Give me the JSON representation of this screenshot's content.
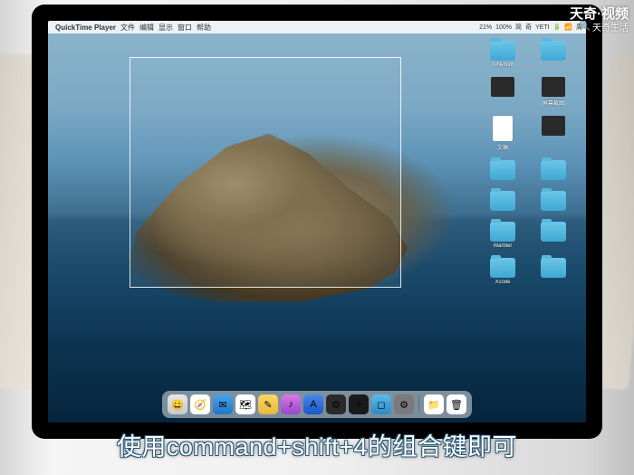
{
  "watermark": {
    "main": "天奇·视频",
    "sub": "天奇生活"
  },
  "subtitle": "使用command+shift+4的组合键即可",
  "menubar": {
    "apple": "",
    "app": "QuickTime Player",
    "items": [
      "文件",
      "编辑",
      "显示",
      "窗口",
      "帮助"
    ],
    "status": [
      "21%",
      "100%",
      "简",
      "奇",
      "YETI",
      "🔋",
      "📶",
      "周"
    ]
  },
  "desktop": {
    "icons": [
      {
        "type": "fld",
        "label": "XINPoint"
      },
      {
        "type": "fld",
        "label": ""
      },
      {
        "type": "dark",
        "label": ""
      },
      {
        "type": "dark",
        "label": "屏幕截图"
      },
      {
        "type": "file",
        "label": "文稿"
      },
      {
        "type": "dark",
        "label": ""
      },
      {
        "type": "fld",
        "label": ""
      },
      {
        "type": "fld",
        "label": ""
      },
      {
        "type": "fld",
        "label": ""
      },
      {
        "type": "fld",
        "label": ""
      },
      {
        "type": "fld",
        "label": "Warbler"
      },
      {
        "type": "fld",
        "label": ""
      },
      {
        "type": "fld",
        "label": "Xcode"
      },
      {
        "type": "fld",
        "label": ""
      }
    ]
  },
  "dock": {
    "apps": [
      {
        "bg": "linear-gradient(#e8e8e8,#c8c8c8)",
        "glyph": "😀"
      },
      {
        "bg": "#fff",
        "glyph": "🧭"
      },
      {
        "bg": "linear-gradient(#4aa3e8,#1f77c8)",
        "glyph": "✉"
      },
      {
        "bg": "#fff",
        "glyph": "🗺"
      },
      {
        "bg": "linear-gradient(#f8d862,#e8b742)",
        "glyph": "✎"
      },
      {
        "bg": "linear-gradient(#d878e8,#9848c8)",
        "glyph": "♪"
      },
      {
        "bg": "linear-gradient(#4888e8,#1858c8)",
        "glyph": "A"
      },
      {
        "bg": "#2a2a2a",
        "glyph": "⚙"
      },
      {
        "bg": "#1a1a1a",
        "glyph": ">"
      },
      {
        "bg": "linear-gradient(#5abae8,#2a8ac8)",
        "glyph": "◻"
      },
      {
        "bg": "#7a7a7a",
        "glyph": "⚙"
      },
      {
        "bg": "#fff",
        "glyph": "📁"
      },
      {
        "bg": "#fff",
        "glyph": "🗑"
      }
    ]
  }
}
